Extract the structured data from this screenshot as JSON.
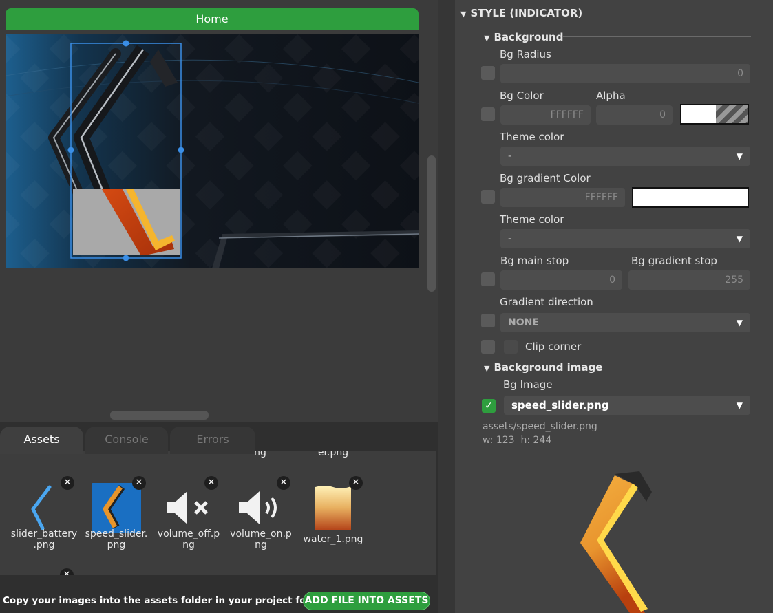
{
  "screen": {
    "tab_label": "Home"
  },
  "bottom_tabs": [
    {
      "label": "Assets"
    },
    {
      "label": "Console"
    },
    {
      "label": "Errors"
    }
  ],
  "assets": {
    "cut_labels": [
      "ng",
      "er.png"
    ],
    "items": [
      {
        "name_line1": "slider_battery",
        "name_line2": ".png"
      },
      {
        "name_line1": "speed_slider.",
        "name_line2": "png"
      },
      {
        "name_line1": "volume_off.p",
        "name_line2": "ng"
      },
      {
        "name_line1": "volume_on.p",
        "name_line2": "ng"
      },
      {
        "name_line1": "water_1.png",
        "name_line2": ""
      }
    ],
    "hint": "Copy your images into the assets folder in your project folder",
    "add_button": "ADD FILE INTO ASSETS"
  },
  "style": {
    "title": "STYLE (INDICATOR)",
    "background_section": "Background",
    "bg_radius_label": "Bg Radius",
    "bg_radius_value": "0",
    "bg_color_label": "Bg Color",
    "bg_color_value": "FFFFFF",
    "alpha_label": "Alpha",
    "alpha_value": "0",
    "theme_color_label": "Theme color",
    "theme_color_value": "-",
    "bg_gradient_label": "Bg gradient Color",
    "bg_gradient_value": "FFFFFF",
    "theme_color2_label": "Theme color",
    "theme_color2_value": "-",
    "bg_main_stop_label": "Bg main stop",
    "bg_main_stop_value": "0",
    "bg_gradient_stop_label": "Bg gradient stop",
    "bg_gradient_stop_value": "255",
    "gradient_direction_label": "Gradient direction",
    "gradient_direction_value": "NONE",
    "clip_corner_label": "Clip corner",
    "bg_image_section": "Background image",
    "bg_image_label": "Bg Image",
    "bg_image_value": "speed_slider.png",
    "image_path": "assets/speed_slider.png",
    "image_dims": "w: 123  h: 244"
  },
  "colors": {
    "accent_green": "#2e9e3e",
    "selection_blue": "#3a8ee6",
    "panel_bg": "#424242"
  }
}
